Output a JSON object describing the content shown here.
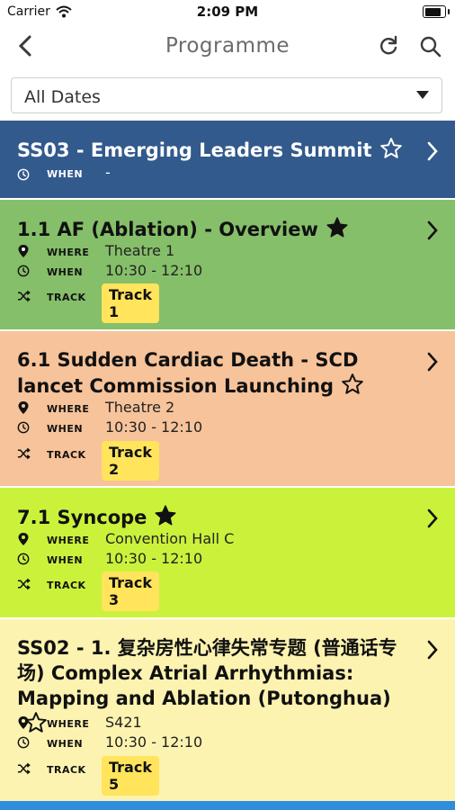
{
  "status_bar": {
    "carrier": "Carrier",
    "time": "2:09 PM",
    "battery_level": 0.95
  },
  "nav": {
    "title": "Programme",
    "back_icon": "chevron-left-icon",
    "refresh_icon": "refresh-icon",
    "search_icon": "search-icon"
  },
  "filter": {
    "selected": "All Dates"
  },
  "labels": {
    "where": "WHERE",
    "when": "WHEN",
    "track": "TRACK"
  },
  "sessions": [
    {
      "title": "SS03 - Emerging Leaders Summit",
      "favorite": false,
      "when": "-",
      "background": "#325a8c",
      "text_color": "#ffffff"
    },
    {
      "title": "1.1 AF (Ablation) - Overview",
      "favorite": true,
      "where": "Theatre 1",
      "when": "10:30 - 12:10",
      "track": "Track 1",
      "background": "#85bf69"
    },
    {
      "title": "6.1 Sudden Cardiac Death - SCD lancet Commission Launching",
      "favorite": false,
      "where": "Theatre 2",
      "when": "10:30 - 12:10",
      "track": "Track 2",
      "background": "#f7c39a"
    },
    {
      "title": "7.1 Syncope",
      "favorite": true,
      "where": "Convention Hall C",
      "when": "10:30 - 12:10",
      "track": "Track 3",
      "background": "#cbf23b"
    },
    {
      "title": "SS02 - 1. 复杂房性心律失常专题 (普通话专场) Complex Atrial Arrhythmias: Mapping and Ablation (Putonghua)",
      "favorite": false,
      "where": "S421",
      "when": "10:30 - 12:10",
      "track": "Track 5",
      "background": "#fdf3b0"
    }
  ],
  "colors": {
    "badge": "#ffe45c",
    "accent": "#2f8ddc"
  }
}
